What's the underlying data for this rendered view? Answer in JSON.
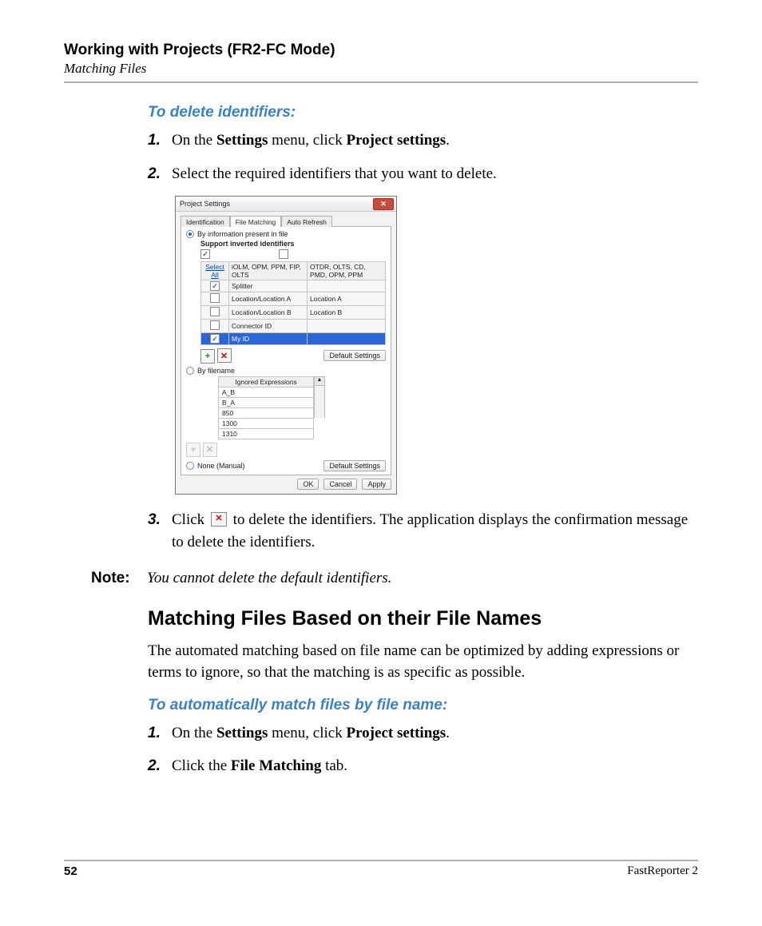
{
  "header": {
    "title": "Working with Projects (FR2-FC Mode)",
    "subtitle": "Matching Files"
  },
  "proc1": {
    "heading": "To delete identifiers:",
    "steps": {
      "s1_num": "1.",
      "s1_a": "On the ",
      "s1_b": "Settings",
      "s1_c": " menu, click ",
      "s1_d": "Project settings",
      "s1_e": ".",
      "s2_num": "2.",
      "s2_a": "Select the required identifiers that you want to delete.",
      "s3_num": "3.",
      "s3_a": "Click ",
      "s3_b": " to delete the identifiers. The application displays the confirmation message to delete the identifiers."
    }
  },
  "note": {
    "label": "Note:",
    "text": "You cannot delete the default identifiers."
  },
  "section2": {
    "heading": "Matching Files Based on their File Names",
    "para": "The automated matching based on file name can be optimized by adding expressions or terms to ignore, so that the matching is as specific as possible.",
    "proc_heading": "To automatically match files by file name:",
    "s1_num": "1.",
    "s1_a": "On the ",
    "s1_b": "Settings",
    "s1_c": " menu, click ",
    "s1_d": "Project settings",
    "s1_e": ".",
    "s2_num": "2.",
    "s2_a": "Click the ",
    "s2_b": "File Matching",
    "s2_c": " tab."
  },
  "dialog": {
    "title": "Project Settings",
    "tabs": {
      "id": "Identification",
      "fm": "File Matching",
      "ar": "Auto Refresh"
    },
    "opt_info": "By information present in file",
    "support": "Support inverted identifiers",
    "sel_hd": "Select All",
    "col2": "iOLM, OPM, PPM, FIP, OLTS",
    "col3": "OTDR, OLTS, CD, PMD, OPM, PPM",
    "rows": [
      {
        "c": false,
        "a": "Splitter",
        "b": ""
      },
      {
        "c": false,
        "a": "Location/Location A",
        "b": "Location A"
      },
      {
        "c": false,
        "a": "Location/Location B",
        "b": "Location B"
      },
      {
        "c": false,
        "a": "Connector ID",
        "b": ""
      },
      {
        "c": true,
        "a": "My ID",
        "b": ""
      }
    ],
    "default_btn": "Default Settings",
    "opt_fname": "By filename",
    "ign_hd": "Ignored Expressions",
    "ign_rows": [
      "A_B",
      "B_A",
      "850",
      "1300",
      "1310"
    ],
    "opt_none": "None (Manual)",
    "ok": "OK",
    "cancel": "Cancel",
    "apply": "Apply"
  },
  "footer": {
    "page": "52",
    "product": "FastReporter 2"
  },
  "inline_x": "✕"
}
